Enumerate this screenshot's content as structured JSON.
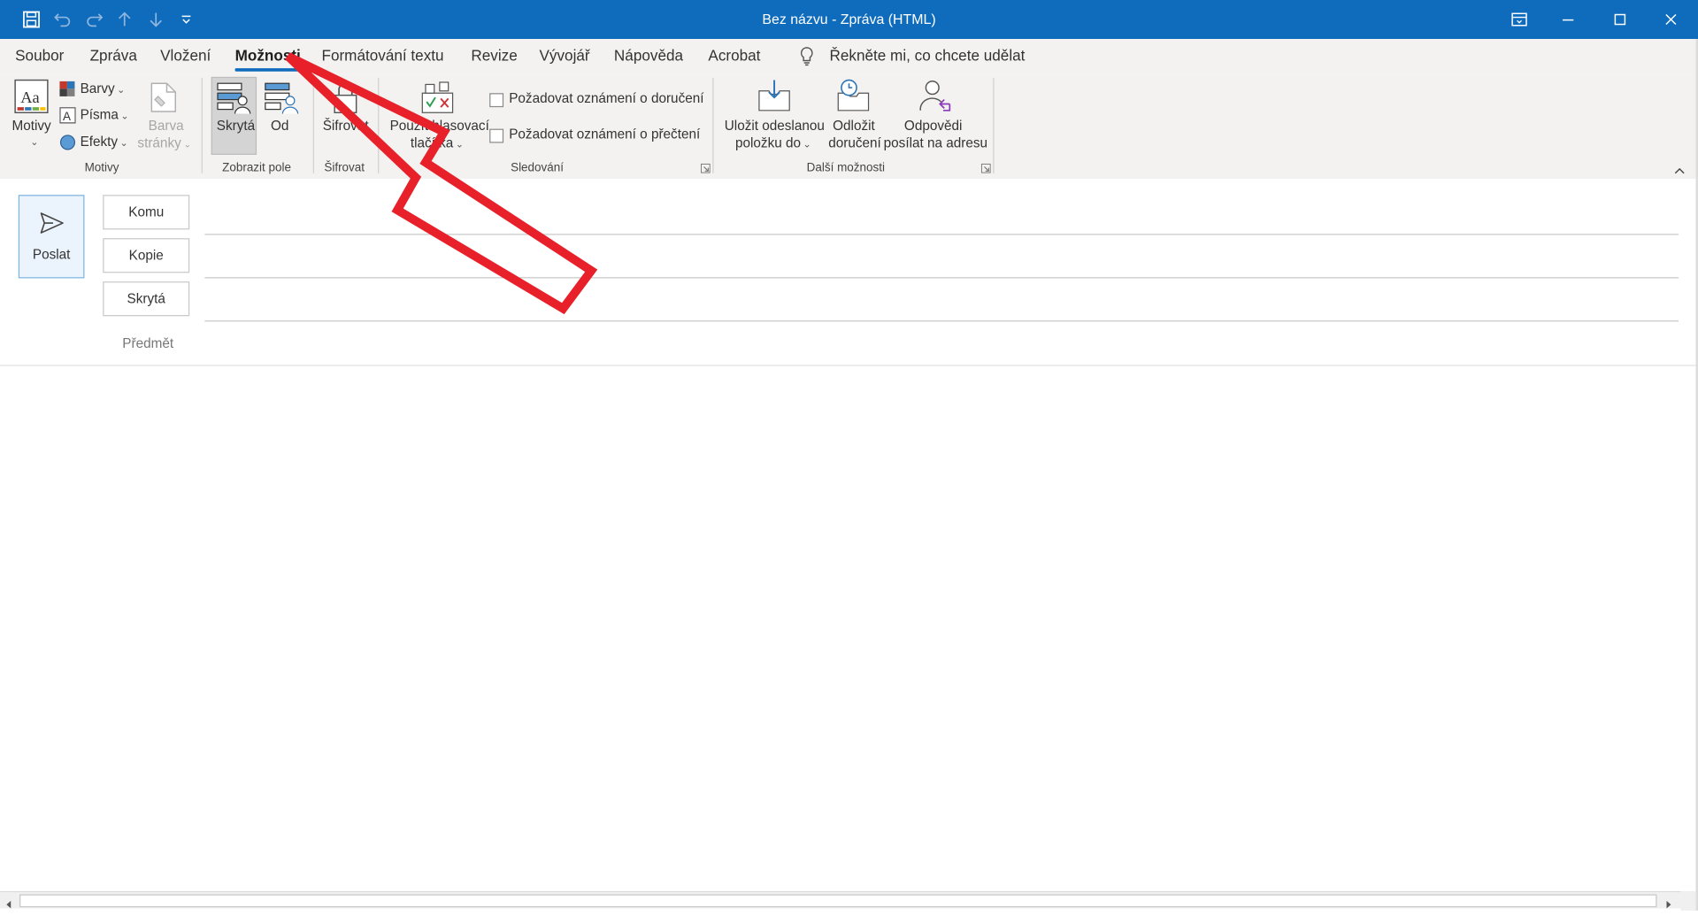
{
  "window": {
    "title": "Bez názvu  -  Zpráva (HTML)"
  },
  "tabs": [
    "Soubor",
    "Zpráva",
    "Vložení",
    "Možnosti",
    "Formátování textu",
    "Revize",
    "Vývojář",
    "Nápověda",
    "Acrobat"
  ],
  "active_tab": "Možnosti",
  "tell_me": "Řekněte mi, co chcete udělat",
  "ribbon": {
    "motivy": {
      "button": "Motivy",
      "barvy": "Barvy",
      "pisma": "Písma",
      "efekty": "Efekty",
      "barva_line1": "Barva",
      "barva_line2": "stránky",
      "group": "Motivy"
    },
    "zobrazit_pole": {
      "skryta": "Skrytá",
      "od": "Od",
      "group": "Zobrazit pole"
    },
    "sifrovat": {
      "button": "Šifrovat",
      "group": "Šifrovat"
    },
    "sledovani": {
      "hlasovaci_line1": "Použít hlasovací",
      "hlasovaci_line2": "tlačítka",
      "doruceni": "Požadovat oznámení o doručení",
      "precteni": "Požadovat oznámení o přečtení",
      "group": "Sledování"
    },
    "dalsi": {
      "ulozit_line1": "Uložit odeslanou",
      "ulozit_line2": "položku do",
      "odlozit_line1": "Odložit",
      "odlozit_line2": "doručení",
      "odpovedi_line1": "Odpovědi",
      "odpovedi_line2": "posílat na adresu",
      "group": "Další možnosti"
    }
  },
  "compose": {
    "send": "Poslat",
    "to": "Komu",
    "cc": "Kopie",
    "bcc": "Skrytá",
    "subject": "Předmět"
  },
  "colors": {
    "titlebar": "#0f6cbd",
    "arrow": "#e8202a",
    "ribbon": "#f3f2f1"
  }
}
